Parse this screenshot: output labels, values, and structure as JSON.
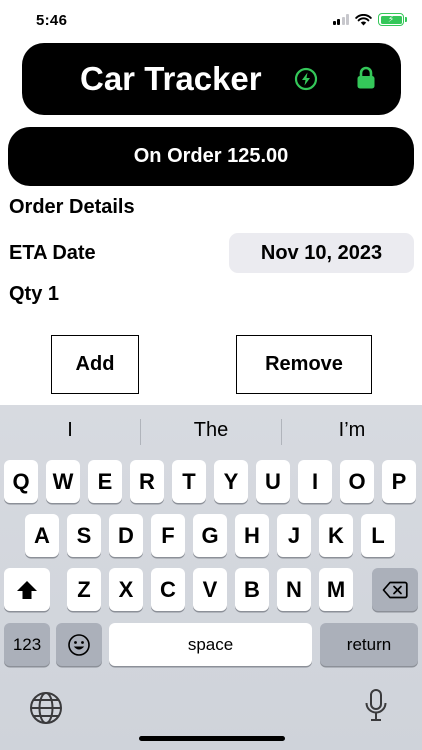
{
  "status": {
    "time": "5:46"
  },
  "header": {
    "title": "Car Tracker"
  },
  "order": {
    "button_label": "On Order 125.00"
  },
  "details": {
    "section_label": "Order Details",
    "eta_label": "ETA Date",
    "eta_value": "Nov 10, 2023",
    "qty_label": "Qty 1"
  },
  "actions": {
    "add_label": "Add",
    "remove_label": "Remove"
  },
  "keyboard": {
    "suggestions": [
      "I",
      "The",
      "I’m"
    ],
    "row1": [
      "Q",
      "W",
      "E",
      "R",
      "T",
      "Y",
      "U",
      "I",
      "O",
      "P"
    ],
    "row2": [
      "A",
      "S",
      "D",
      "F",
      "G",
      "H",
      "J",
      "K",
      "L"
    ],
    "row3": [
      "Z",
      "X",
      "C",
      "V",
      "B",
      "N",
      "M"
    ],
    "numbers_label": "123",
    "space_label": "space",
    "return_label": "return"
  },
  "colors": {
    "accent_green": "#34c759",
    "banner": "#000000"
  },
  "icons": [
    "signal-icon",
    "wifi-icon",
    "battery-icon",
    "bolt-icon",
    "lock-icon",
    "shift-icon",
    "delete-icon",
    "emoji-icon",
    "globe-icon",
    "mic-icon"
  ]
}
